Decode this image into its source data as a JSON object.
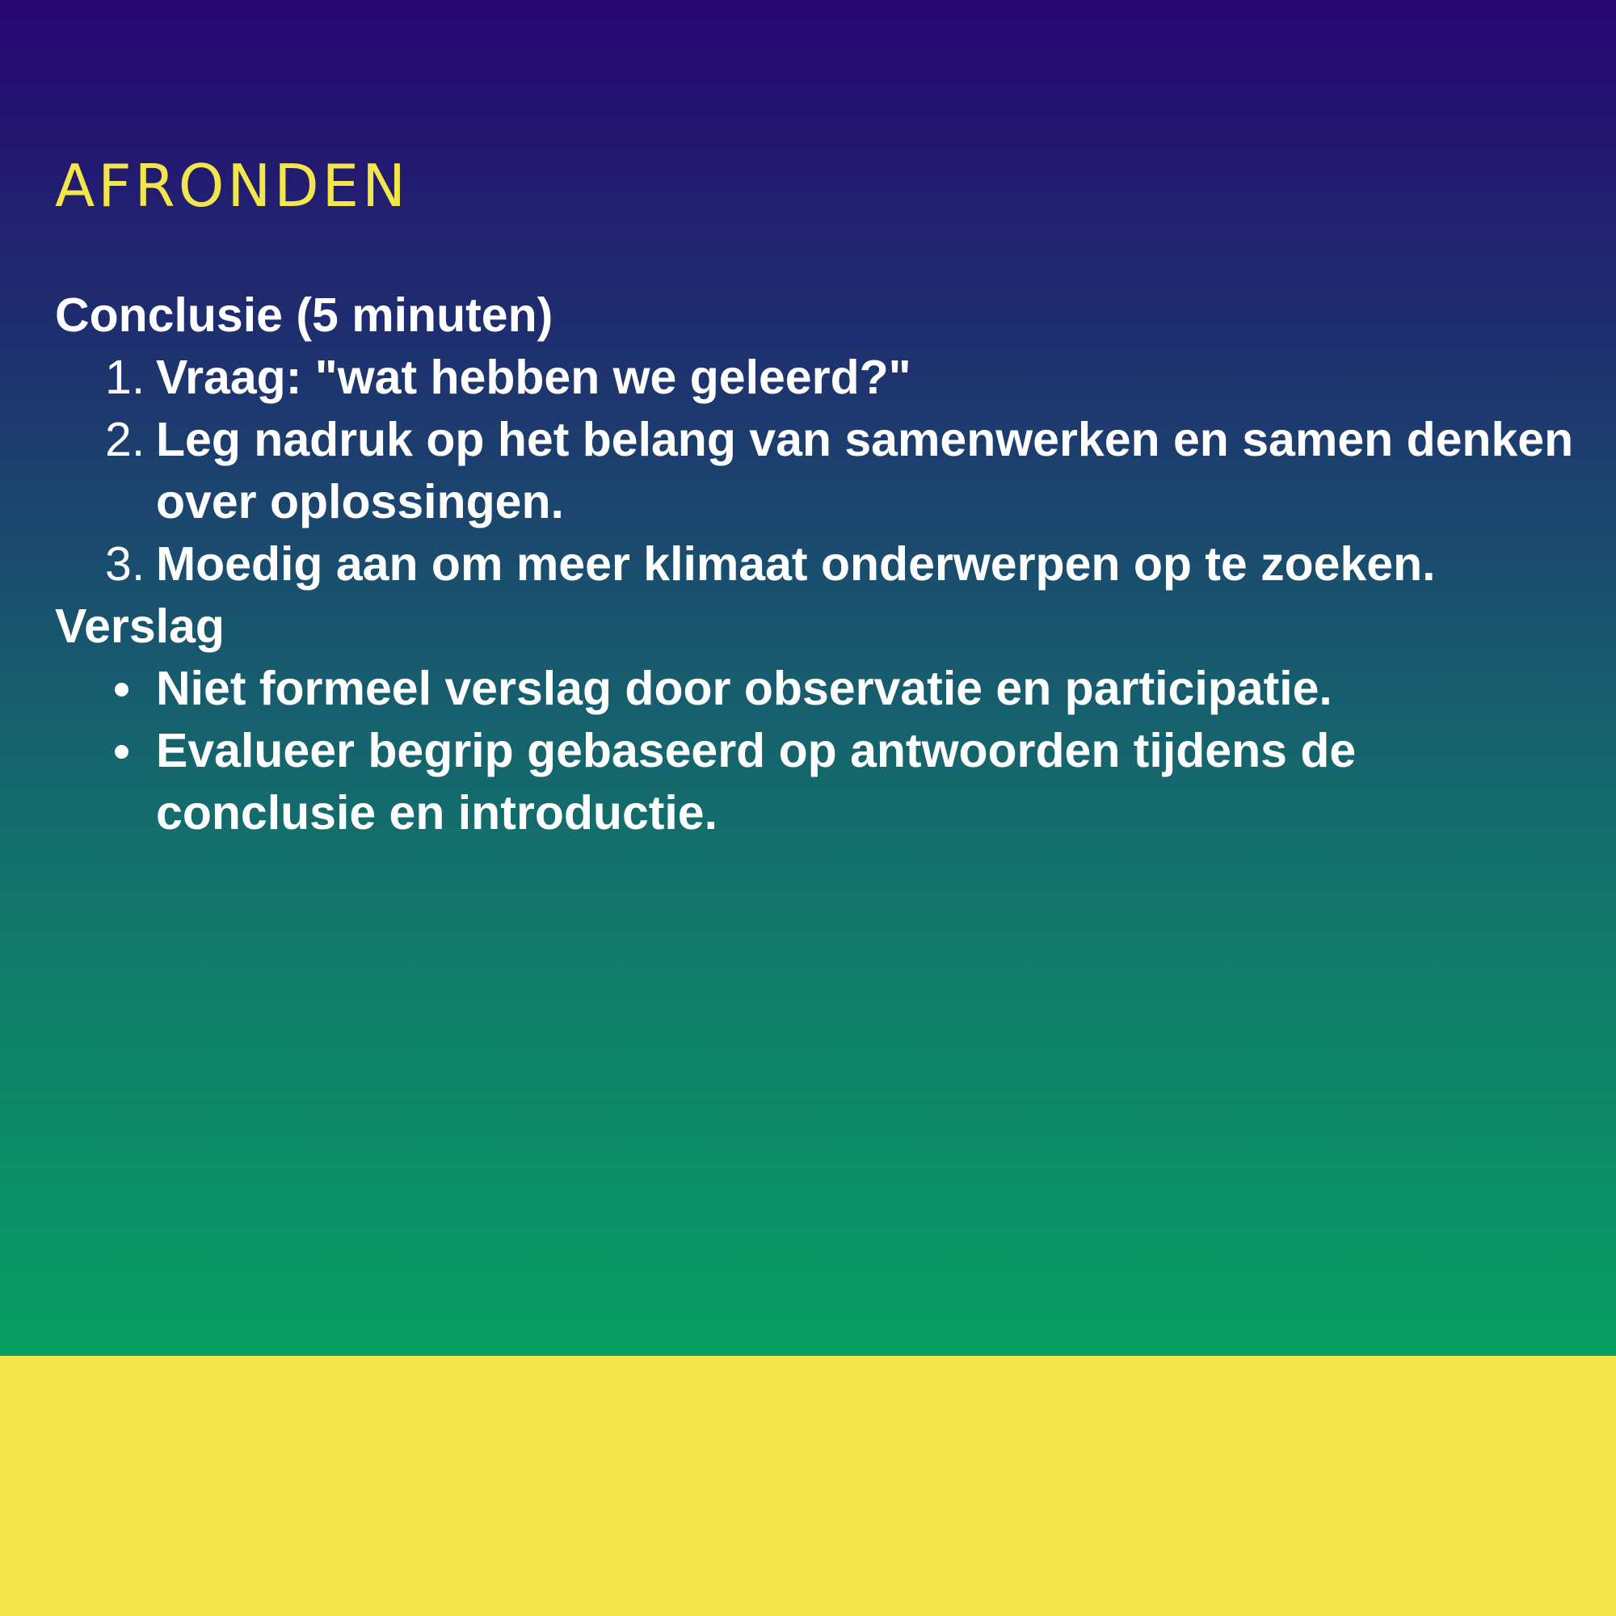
{
  "slide": {
    "title": "AFRONDEN",
    "sections": [
      {
        "heading": "Conclusie (5 minuten)",
        "list_type": "numbered",
        "items": [
          {
            "marker": "1.",
            "text": "Vraag: \"wat hebben we geleerd?\""
          },
          {
            "marker": "2.",
            "text": "Leg nadruk op het belang van samenwerken en samen denken over oplossingen."
          },
          {
            "marker": "3.",
            "text": "Moedig aan om meer klimaat onderwerpen op te zoeken."
          }
        ]
      },
      {
        "heading": "Verslag",
        "list_type": "bullet",
        "items": [
          {
            "text": "Niet formeel verslag door observatie en participatie."
          },
          {
            "text": "Evalueer begrip gebaseerd op antwoorden tijdens de conclusie en introductie."
          }
        ]
      }
    ]
  },
  "colors": {
    "gradient_top": "#270672",
    "gradient_bottom": "#079e64",
    "accent_yellow": "#f2e64b",
    "text": "#ffffff"
  }
}
